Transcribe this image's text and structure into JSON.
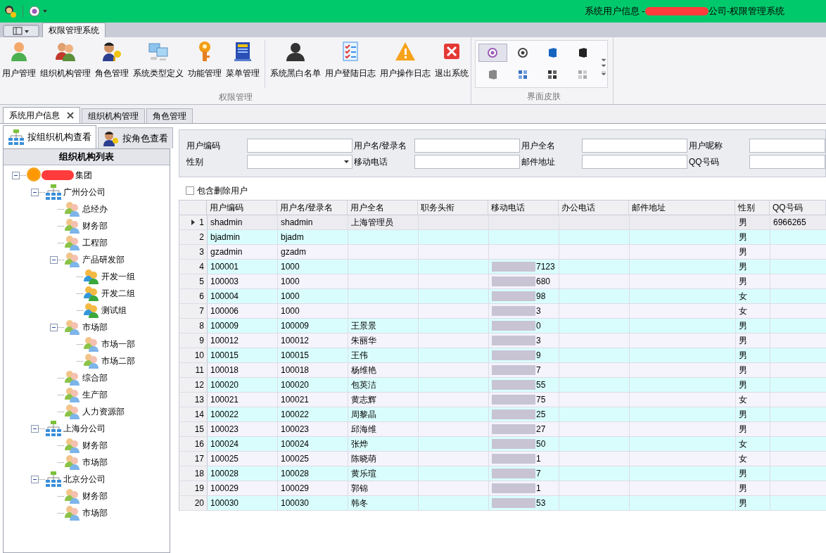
{
  "window": {
    "title_start": "系统用户信息 - ",
    "title_end": "公司-权限管理系统"
  },
  "ribbon_tabs": [
    {
      "label": "权限管理系统",
      "selected": true
    }
  ],
  "ribbon_groups": [
    {
      "caption": "权限管理",
      "buttons": [
        {
          "label": "用户管理",
          "kind": "user"
        },
        {
          "label": "组织机构管理",
          "kind": "users"
        },
        {
          "label": "角色管理",
          "kind": "role"
        },
        {
          "label": "系统类型定义",
          "kind": "monitors"
        },
        {
          "label": "功能管理",
          "kind": "key"
        },
        {
          "label": "菜单管理",
          "kind": "book"
        },
        {
          "label": "系统黑白名单",
          "kind": "silhouette"
        },
        {
          "label": "用户登陆日志",
          "kind": "checklist"
        },
        {
          "label": "用户操作日志",
          "kind": "warning"
        },
        {
          "label": "退出系统",
          "kind": "exit"
        }
      ]
    }
  ],
  "skin_group": {
    "caption": "界面皮肤",
    "skins": [
      {
        "kind": "badge",
        "selected": true
      },
      {
        "kind": "badge-dark",
        "selected": false
      },
      {
        "kind": "office-blue",
        "selected": false
      },
      {
        "kind": "office-dark",
        "selected": false
      },
      {
        "kind": "office-gray",
        "selected": false
      },
      {
        "kind": "tiles-blue",
        "selected": false
      },
      {
        "kind": "tiles-dark",
        "selected": false
      },
      {
        "kind": "tiles-light",
        "selected": false
      }
    ]
  },
  "doc_tabs": [
    {
      "label": "系统用户信息",
      "selected": true,
      "closable": true
    },
    {
      "label": "组织机构管理",
      "selected": false,
      "closable": false
    },
    {
      "label": "角色管理",
      "selected": false,
      "closable": false
    }
  ],
  "view_tabs": [
    {
      "label": "按组织机构查看",
      "kind": "org",
      "selected": true
    },
    {
      "label": "按角色查看",
      "kind": "role",
      "selected": false
    }
  ],
  "tree": {
    "title": "组织机构列表",
    "nodes": [
      {
        "label": "集团",
        "kind": "root",
        "redacted": true,
        "expanded": true,
        "children": [
          {
            "label": "广州分公司",
            "kind": "company",
            "expanded": true,
            "children": [
              {
                "label": "总经办",
                "kind": "dept"
              },
              {
                "label": "财务部",
                "kind": "dept"
              },
              {
                "label": "工程部",
                "kind": "dept"
              },
              {
                "label": "产品研发部",
                "kind": "dept",
                "expanded": true,
                "children": [
                  {
                    "label": "开发一组",
                    "kind": "team"
                  },
                  {
                    "label": "开发二组",
                    "kind": "team"
                  },
                  {
                    "label": "测试组",
                    "kind": "team"
                  }
                ]
              },
              {
                "label": "市场部",
                "kind": "dept",
                "expanded": true,
                "children": [
                  {
                    "label": "市场一部",
                    "kind": "dept"
                  },
                  {
                    "label": "市场二部",
                    "kind": "dept"
                  }
                ]
              },
              {
                "label": "综合部",
                "kind": "dept"
              },
              {
                "label": "生产部",
                "kind": "dept"
              },
              {
                "label": "人力资源部",
                "kind": "dept"
              }
            ]
          },
          {
            "label": "上海分公司",
            "kind": "company",
            "expanded": true,
            "children": [
              {
                "label": "财务部",
                "kind": "dept"
              },
              {
                "label": "市场部",
                "kind": "dept"
              }
            ]
          },
          {
            "label": "北京分公司",
            "kind": "company",
            "expanded": true,
            "children": [
              {
                "label": "财务部",
                "kind": "dept"
              },
              {
                "label": "市场部",
                "kind": "dept"
              }
            ]
          }
        ]
      }
    ]
  },
  "filters": [
    {
      "label": "用户编码",
      "kind": "text"
    },
    {
      "label": "用户名/登录名",
      "kind": "text"
    },
    {
      "label": "用户全名",
      "kind": "text"
    },
    {
      "label": "用户呢称",
      "kind": "text"
    },
    {
      "label": "性别",
      "kind": "select"
    },
    {
      "label": "移动电话",
      "kind": "text"
    },
    {
      "label": "邮件地址",
      "kind": "text"
    },
    {
      "label": "QQ号码",
      "kind": "text"
    }
  ],
  "include_deleted": {
    "label": "包含删除用户",
    "checked": false
  },
  "table": {
    "columns": [
      "用户编码",
      "用户名/登录名",
      "用户全名",
      "职务头衔",
      "移动电话",
      "办公电话",
      "邮件地址",
      "性别",
      "QQ号码"
    ],
    "rows": [
      {
        "n": "1",
        "code": "shadmin",
        "login": "shadmin",
        "name": "上海管理员",
        "phone": "",
        "phone_redacted": false,
        "gender": "男",
        "qq": "6966265",
        "selected": true
      },
      {
        "n": "2",
        "code": "bjadmin",
        "login": "bjadm",
        "name": "",
        "phone": "",
        "phone_redacted": false,
        "gender": "男",
        "qq": "",
        "selected": false
      },
      {
        "n": "3",
        "code": "gzadmin",
        "login": "gzadm",
        "name": "",
        "phone": "",
        "phone_redacted": false,
        "gender": "男",
        "qq": "",
        "selected": false
      },
      {
        "n": "4",
        "code": "100001",
        "login": "1000",
        "name": "",
        "phone": "7123",
        "phone_redacted": true,
        "gender": "男",
        "qq": "",
        "selected": false
      },
      {
        "n": "5",
        "code": "100003",
        "login": "1000",
        "name": "",
        "phone": "680",
        "phone_redacted": true,
        "gender": "男",
        "qq": "",
        "selected": false
      },
      {
        "n": "6",
        "code": "100004",
        "login": "1000",
        "name": "",
        "phone": "98",
        "phone_redacted": true,
        "gender": "女",
        "qq": "",
        "selected": false
      },
      {
        "n": "7",
        "code": "100006",
        "login": "1000",
        "name": "",
        "phone": "3",
        "phone_redacted": true,
        "gender": "女",
        "qq": "",
        "selected": false
      },
      {
        "n": "8",
        "code": "100009",
        "login": "100009",
        "name": "王景景",
        "phone": "0",
        "phone_redacted": true,
        "gender": "男",
        "qq": "",
        "selected": false
      },
      {
        "n": "9",
        "code": "100012",
        "login": "100012",
        "name": "朱丽华",
        "phone": "3",
        "phone_redacted": true,
        "gender": "男",
        "qq": "",
        "selected": false
      },
      {
        "n": "10",
        "code": "100015",
        "login": "100015",
        "name": "王伟",
        "phone": "9",
        "phone_redacted": true,
        "gender": "男",
        "qq": "",
        "selected": false
      },
      {
        "n": "11",
        "code": "100018",
        "login": "100018",
        "name": "杨维艳",
        "phone": "7",
        "phone_redacted": true,
        "gender": "男",
        "qq": "",
        "selected": false
      },
      {
        "n": "12",
        "code": "100020",
        "login": "100020",
        "name": "包英洁",
        "phone": "55",
        "phone_redacted": true,
        "gender": "男",
        "qq": "",
        "selected": false
      },
      {
        "n": "13",
        "code": "100021",
        "login": "100021",
        "name": "黄志辉",
        "phone": "75",
        "phone_redacted": true,
        "gender": "女",
        "qq": "",
        "selected": false
      },
      {
        "n": "14",
        "code": "100022",
        "login": "100022",
        "name": "周黎晶",
        "phone": "25",
        "phone_redacted": true,
        "gender": "男",
        "qq": "",
        "selected": false
      },
      {
        "n": "15",
        "code": "100023",
        "login": "100023",
        "name": "邱海维",
        "phone": "27",
        "phone_redacted": true,
        "gender": "男",
        "qq": "",
        "selected": false
      },
      {
        "n": "16",
        "code": "100024",
        "login": "100024",
        "name": "张烨",
        "phone": "50",
        "phone_redacted": true,
        "gender": "女",
        "qq": "",
        "selected": false
      },
      {
        "n": "17",
        "code": "100025",
        "login": "100025",
        "name": "陈晓萌",
        "phone": "1",
        "phone_redacted": true,
        "gender": "女",
        "qq": "",
        "selected": false
      },
      {
        "n": "18",
        "code": "100028",
        "login": "100028",
        "name": "黄乐瑄",
        "phone": "7",
        "phone_redacted": true,
        "gender": "男",
        "qq": "",
        "selected": false
      },
      {
        "n": "19",
        "code": "100029",
        "login": "100029",
        "name": "郭锦",
        "phone": "1",
        "phone_redacted": true,
        "gender": "男",
        "qq": "",
        "selected": false
      },
      {
        "n": "20",
        "code": "100030",
        "login": "100030",
        "name": "韩冬",
        "phone": "53",
        "phone_redacted": true,
        "gender": "男",
        "qq": "",
        "selected": false
      }
    ]
  }
}
